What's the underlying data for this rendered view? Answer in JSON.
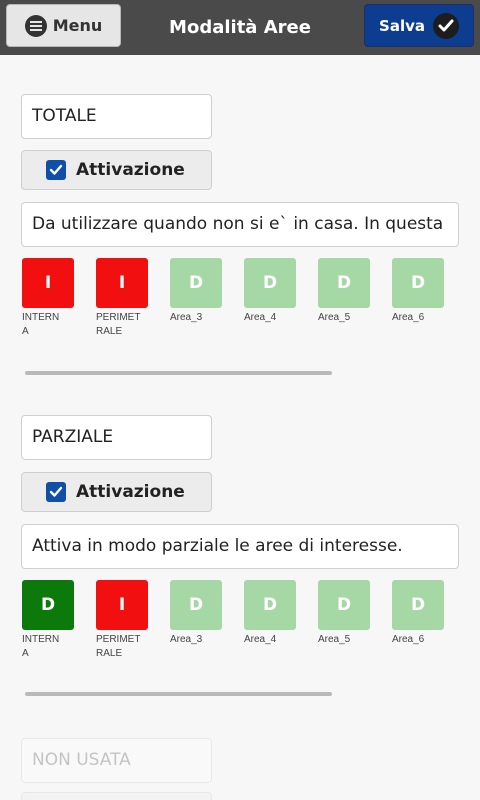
{
  "header": {
    "menu_label": "Menu",
    "title": "Modalità Aree",
    "save_label": "Salva"
  },
  "modes": [
    {
      "name": "TOTALE",
      "activation_label": "Attivazione",
      "activation_checked": true,
      "description": "Da utilizzare quando non si e` in casa. In questa",
      "areas": [
        {
          "state": "I",
          "color": "#f20f0f",
          "label": "INTERN\nA"
        },
        {
          "state": "I",
          "color": "#f20f0f",
          "label": "PERIMET\nRALE"
        },
        {
          "state": "D",
          "color": "#a6d8a6",
          "label": "Area_3"
        },
        {
          "state": "D",
          "color": "#a6d8a6",
          "label": "Area_4"
        },
        {
          "state": "D",
          "color": "#a6d8a6",
          "label": "Area_5"
        },
        {
          "state": "D",
          "color": "#a6d8a6",
          "label": "Area_6"
        }
      ]
    },
    {
      "name": "PARZIALE",
      "activation_label": "Attivazione",
      "activation_checked": true,
      "description": "Attiva in modo parziale le aree di interesse.",
      "areas": [
        {
          "state": "D",
          "color": "#0b7a0b",
          "label": "INTERN\nA"
        },
        {
          "state": "I",
          "color": "#f20f0f",
          "label": "PERIMET\nRALE"
        },
        {
          "state": "D",
          "color": "#a6d8a6",
          "label": "Area_3"
        },
        {
          "state": "D",
          "color": "#a6d8a6",
          "label": "Area_4"
        },
        {
          "state": "D",
          "color": "#a6d8a6",
          "label": "Area_5"
        },
        {
          "state": "D",
          "color": "#a6d8a6",
          "label": "Area_6"
        }
      ]
    },
    {
      "name": "NON USATA"
    }
  ]
}
